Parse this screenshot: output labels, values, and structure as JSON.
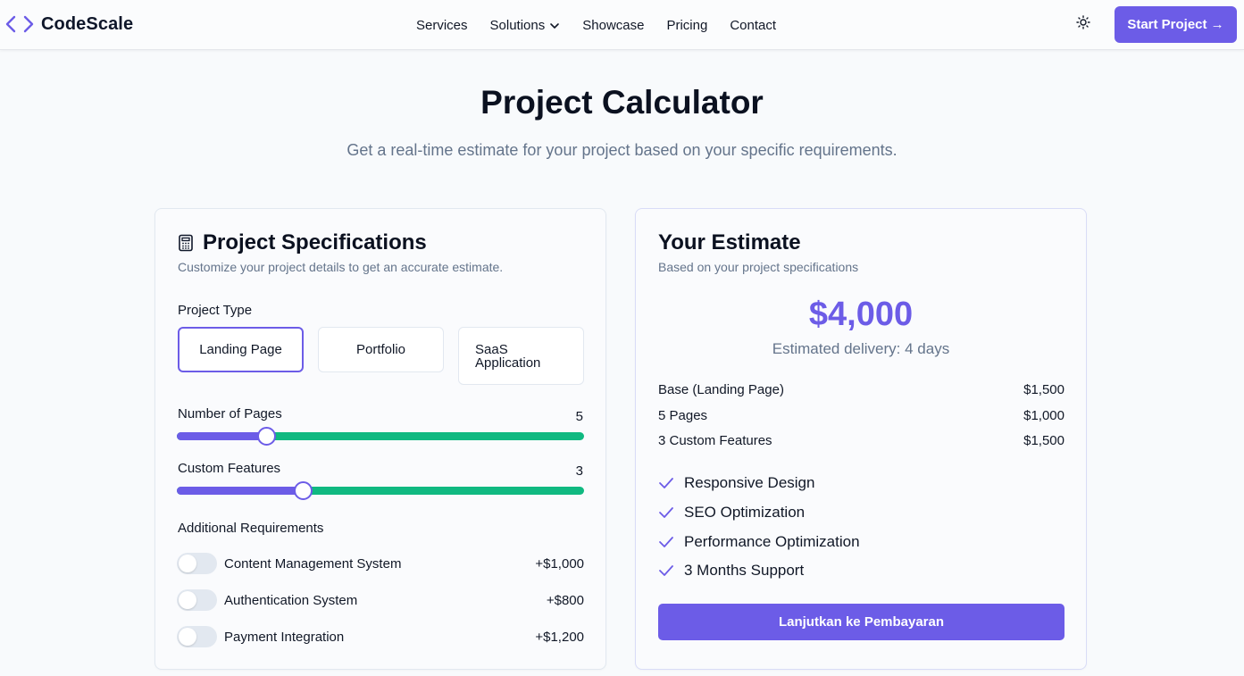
{
  "header": {
    "brand": "CodeScale",
    "nav": [
      {
        "label": "Services"
      },
      {
        "label": "Solutions"
      },
      {
        "label": "Showcase"
      },
      {
        "label": "Pricing"
      },
      {
        "label": "Contact"
      }
    ],
    "cta_label": "Start Project →"
  },
  "hero": {
    "title": "Project Calculator",
    "subtitle": "Get a real-time estimate for your project based on your specific requirements."
  },
  "specs": {
    "title": "Project Specifications",
    "description": "Customize your project details to get an accurate estimate.",
    "project_type_label": "Project Type",
    "project_types": [
      {
        "label": "Landing Page",
        "selected": true
      },
      {
        "label": "Portfolio",
        "selected": false
      },
      {
        "label": "SaaS\nApplication",
        "selected": false
      }
    ],
    "pages": {
      "label": "Number of Pages",
      "value": "5",
      "fraction": 0.22
    },
    "features": {
      "label": "Custom Features",
      "value": "3",
      "fraction": 0.31
    },
    "additional_label": "Additional Requirements",
    "requirements": [
      {
        "label": "Content Management System",
        "price": "+$1,000",
        "enabled": false
      },
      {
        "label": "Authentication System",
        "price": "+$800",
        "enabled": false
      },
      {
        "label": "Payment Integration",
        "price": "+$1,200",
        "enabled": false
      }
    ]
  },
  "estimate": {
    "title": "Your Estimate",
    "description": "Based on your project specifications",
    "price": "$4,000",
    "delivery": "Estimated delivery: 4 days",
    "breakdown": [
      {
        "label": "Base (Landing Page)",
        "amount": "$1,500"
      },
      {
        "label": "5 Pages",
        "amount": "$1,000"
      },
      {
        "label": "3 Custom Features",
        "amount": "$1,500"
      }
    ],
    "included": [
      "Responsive Design",
      "SEO Optimization",
      "Performance Optimization",
      "3 Months Support"
    ],
    "pay_label": "Lanjutkan ke Pembayaran"
  },
  "colors": {
    "accent": "#6c5ce7",
    "slider_rest": "#10b981",
    "muted_text": "#64748b"
  }
}
